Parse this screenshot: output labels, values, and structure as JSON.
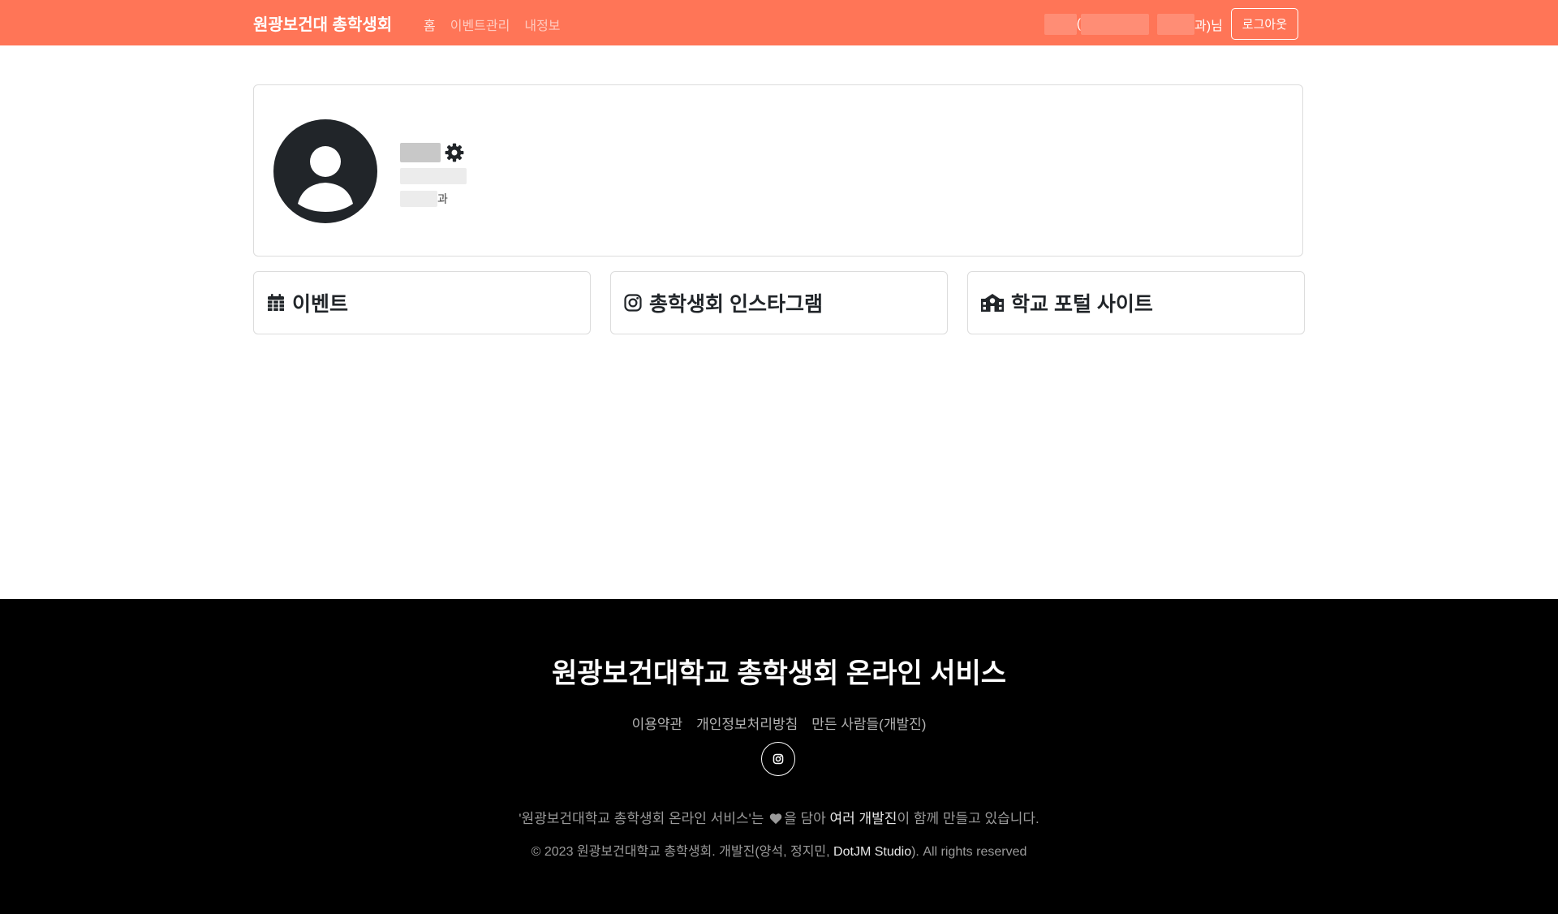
{
  "navbar": {
    "brand": "원광보건대 총학생회",
    "links": [
      {
        "label": "홈"
      },
      {
        "label": "이벤트관리"
      },
      {
        "label": "내정보"
      }
    ],
    "user_greeting_open": "(",
    "user_greeting_close": "과)님",
    "logout_label": "로그아웃"
  },
  "profile": {
    "department_suffix": "과",
    "settings_icon": "gear-icon",
    "avatar_icon": "user-circle-icon"
  },
  "cards": [
    {
      "title": "이벤트",
      "icon": "calendar-icon"
    },
    {
      "title": "총학생회 인스타그램",
      "icon": "instagram-icon"
    },
    {
      "title": "학교 포털 사이트",
      "icon": "school-icon"
    }
  ],
  "footer": {
    "title": "원광보건대학교 총학생회 온라인 서비스",
    "links": [
      {
        "label": "이용약관"
      },
      {
        "label": "개인정보처리방침"
      },
      {
        "label": "만든 사람들(개발진)"
      }
    ],
    "instagram_icon": "instagram-icon",
    "note_prefix": "'원광보건대학교 총학생회 온라인 서비스'는 ",
    "note_middle": "을 담아 ",
    "note_highlight": "여러 개발진",
    "note_suffix": "이 함께 만들고 있습니다.",
    "copyright_prefix": "© 2023 원광보건대학교 총학생회. 개발진(양석, 정지민, ",
    "copyright_highlight": "DotJM Studio",
    "copyright_suffix": "). All rights reserved"
  },
  "colors": {
    "navbar_bg": "#ff7557",
    "footer_bg": "#000000",
    "text_dark": "#212529"
  }
}
